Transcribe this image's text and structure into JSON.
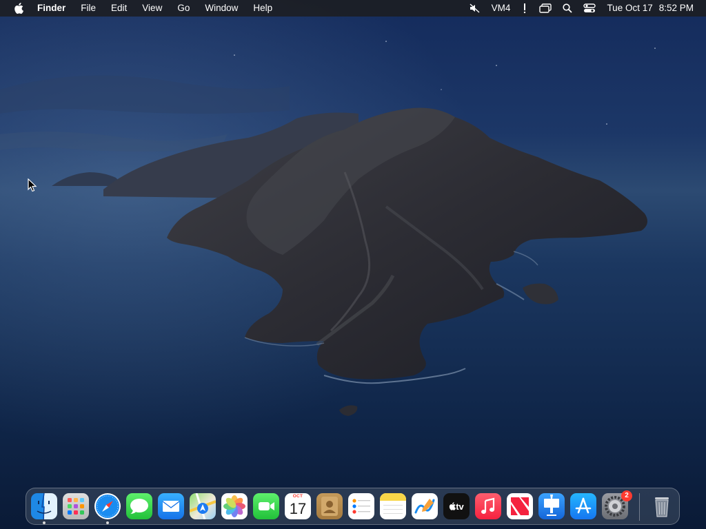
{
  "menubar": {
    "app_name": "Finder",
    "items": [
      "File",
      "Edit",
      "View",
      "Go",
      "Window",
      "Help"
    ],
    "status": {
      "keyboard_label": "VM4",
      "date": "Tue Oct 17",
      "time": "8:52 PM"
    },
    "icons": [
      "apple-logo",
      "volume-muted",
      "keyboard-input",
      "alert",
      "screen-mirroring",
      "search",
      "control-center"
    ]
  },
  "dock": {
    "apps": [
      {
        "name": "Finder",
        "icon": "finder-icon",
        "running": true
      },
      {
        "name": "Launchpad",
        "icon": "launchpad-icon",
        "running": false
      },
      {
        "name": "Safari",
        "icon": "safari-icon",
        "running": true
      },
      {
        "name": "Messages",
        "icon": "messages-icon",
        "running": false
      },
      {
        "name": "Mail",
        "icon": "mail-icon",
        "running": false
      },
      {
        "name": "Maps",
        "icon": "maps-icon",
        "running": false
      },
      {
        "name": "Photos",
        "icon": "photos-icon",
        "running": false
      },
      {
        "name": "FaceTime",
        "icon": "facetime-icon",
        "running": false
      },
      {
        "name": "Calendar",
        "icon": "calendar-icon",
        "running": false
      },
      {
        "name": "Contacts",
        "icon": "contacts-icon",
        "running": false
      },
      {
        "name": "Reminders",
        "icon": "reminders-icon",
        "running": false
      },
      {
        "name": "Notes",
        "icon": "notes-icon",
        "running": false
      },
      {
        "name": "Freeform",
        "icon": "freeform-icon",
        "running": false
      },
      {
        "name": "TV",
        "icon": "tv-icon",
        "running": false
      },
      {
        "name": "Music",
        "icon": "music-icon",
        "running": false
      },
      {
        "name": "News",
        "icon": "news-icon",
        "running": false
      },
      {
        "name": "Keynote",
        "icon": "keynote-icon",
        "running": false
      },
      {
        "name": "App Store",
        "icon": "app-store-icon",
        "running": false
      },
      {
        "name": "System Settings",
        "icon": "system-settings-icon",
        "running": false
      },
      {
        "name": "Trash",
        "icon": "trash-icon",
        "running": false
      }
    ],
    "calendar": {
      "month": "OCT",
      "day": "17"
    },
    "tv_label": "tv",
    "settings_badge": "2"
  },
  "wallpaper": "macos-catalina-island-night"
}
